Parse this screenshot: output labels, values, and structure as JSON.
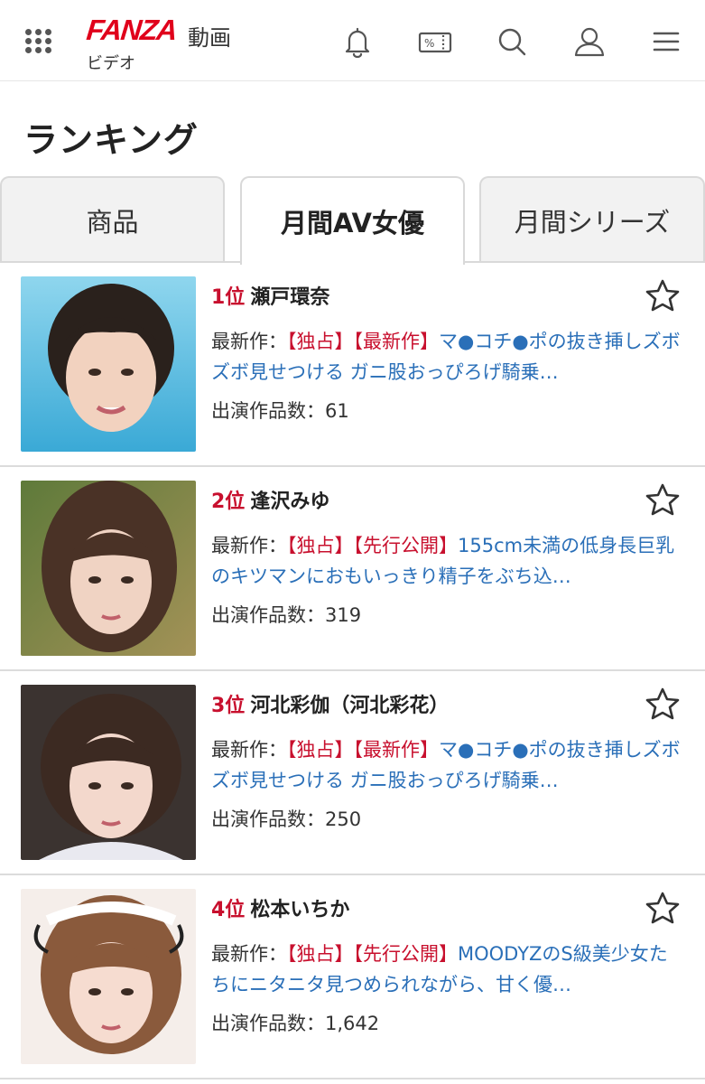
{
  "header": {
    "logo_main": "FANZA",
    "logo_sub": "動画",
    "logo_video": "ビデオ",
    "icons": [
      "menu-grid-icon",
      "bell-icon",
      "coupon-icon",
      "search-icon",
      "user-icon",
      "hamburger-icon"
    ]
  },
  "page": {
    "title": "ランキング"
  },
  "tabs": [
    {
      "label": "商品",
      "active": false
    },
    {
      "label": "月間AV女優",
      "active": true
    },
    {
      "label": "月間シリーズ",
      "active": false
    }
  ],
  "colors": {
    "accent_red": "#c8102e",
    "link_blue": "#2a6fb8",
    "logo_red": "#e0001b"
  },
  "ranking": [
    {
      "rank": "1位",
      "name": "瀬戸環奈",
      "latest_label": "最新作：",
      "tags": "【独占】【最新作】",
      "title": "マ●コチ●ポの抜き挿しズボズボ見せつける ガニ股おっぴろげ騎乗…",
      "count": "出演作品数：61"
    },
    {
      "rank": "2位",
      "name": "逢沢みゆ",
      "latest_label": "最新作：",
      "tags": "【独占】【先行公開】",
      "title": "155cm未満の低身長巨乳のキツマンにおもいっきり精子をぶち込…",
      "count": "出演作品数：319"
    },
    {
      "rank": "3位",
      "name": "河北彩伽（河北彩花）",
      "latest_label": "最新作：",
      "tags": "【独占】【最新作】",
      "title": "マ●コチ●ポの抜き挿しズボズボ見せつける ガニ股おっぴろげ騎乗…",
      "count": "出演作品数：250"
    },
    {
      "rank": "4位",
      "name": "松本いちか",
      "latest_label": "最新作：",
      "tags": "【独占】【先行公開】",
      "title": "MOODYZのS級美少女たちにニタニタ見つめられながら、甘く優…",
      "count": "出演作品数：1,642"
    }
  ]
}
